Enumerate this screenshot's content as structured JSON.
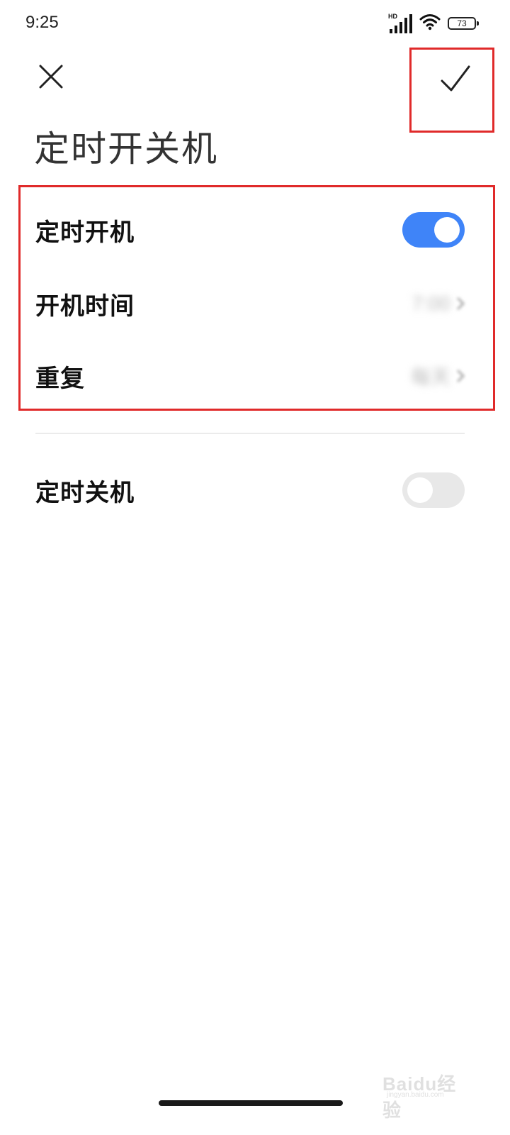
{
  "status_bar": {
    "time": "9:25",
    "network_badge": "HD",
    "battery_level": "73",
    "icons": [
      "signal-icon",
      "wifi-icon",
      "battery-icon"
    ]
  },
  "header": {
    "close_icon": "close-icon",
    "confirm_icon": "check-icon",
    "title": "定时开关机"
  },
  "power_on": {
    "toggle_label": "定时开机",
    "toggle_state": true,
    "time_label": "开机时间",
    "time_value": "7:00",
    "repeat_label": "重复",
    "repeat_value": "每天"
  },
  "power_off": {
    "toggle_label": "定时关机",
    "toggle_state": false
  },
  "watermark": {
    "text": "Baidu经验",
    "sub": "jingyan.baidu.com"
  },
  "colors": {
    "accent": "#3f84f8",
    "highlight": "#e02a2a",
    "toggle_off": "#e8e8e8"
  }
}
